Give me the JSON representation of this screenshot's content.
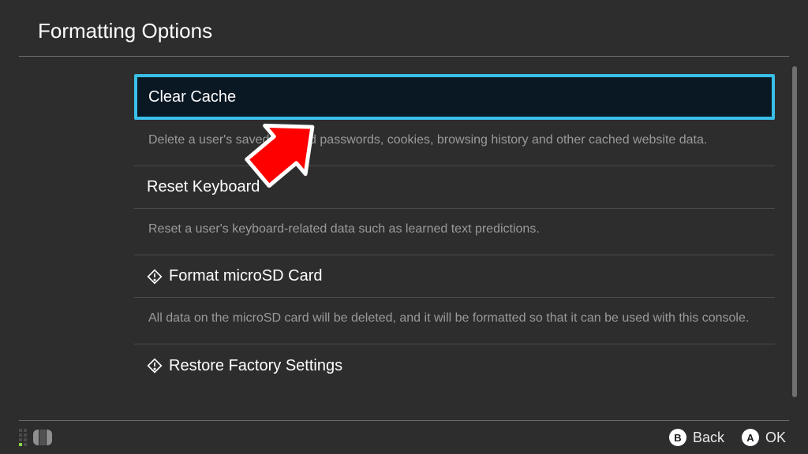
{
  "header": {
    "title": "Formatting Options"
  },
  "options": [
    {
      "title": "Clear Cache",
      "desc": "Delete a user's saved IDs and passwords, cookies, browsing history and other cached website data.",
      "has_warn_icon": false,
      "selected": true
    },
    {
      "title": "Reset Keyboard",
      "desc": "Reset a user's keyboard-related data such as learned text predictions.",
      "has_warn_icon": false,
      "selected": false
    },
    {
      "title": "Format microSD Card",
      "desc": "All data on the microSD card will be deleted, and it will be formatted so that it can be used with this console.",
      "has_warn_icon": true,
      "selected": false
    },
    {
      "title": "Restore Factory Settings",
      "desc": "",
      "has_warn_icon": true,
      "selected": false
    }
  ],
  "footer": {
    "back": {
      "glyph": "B",
      "label": "Back"
    },
    "ok": {
      "glyph": "A",
      "label": "OK"
    }
  }
}
